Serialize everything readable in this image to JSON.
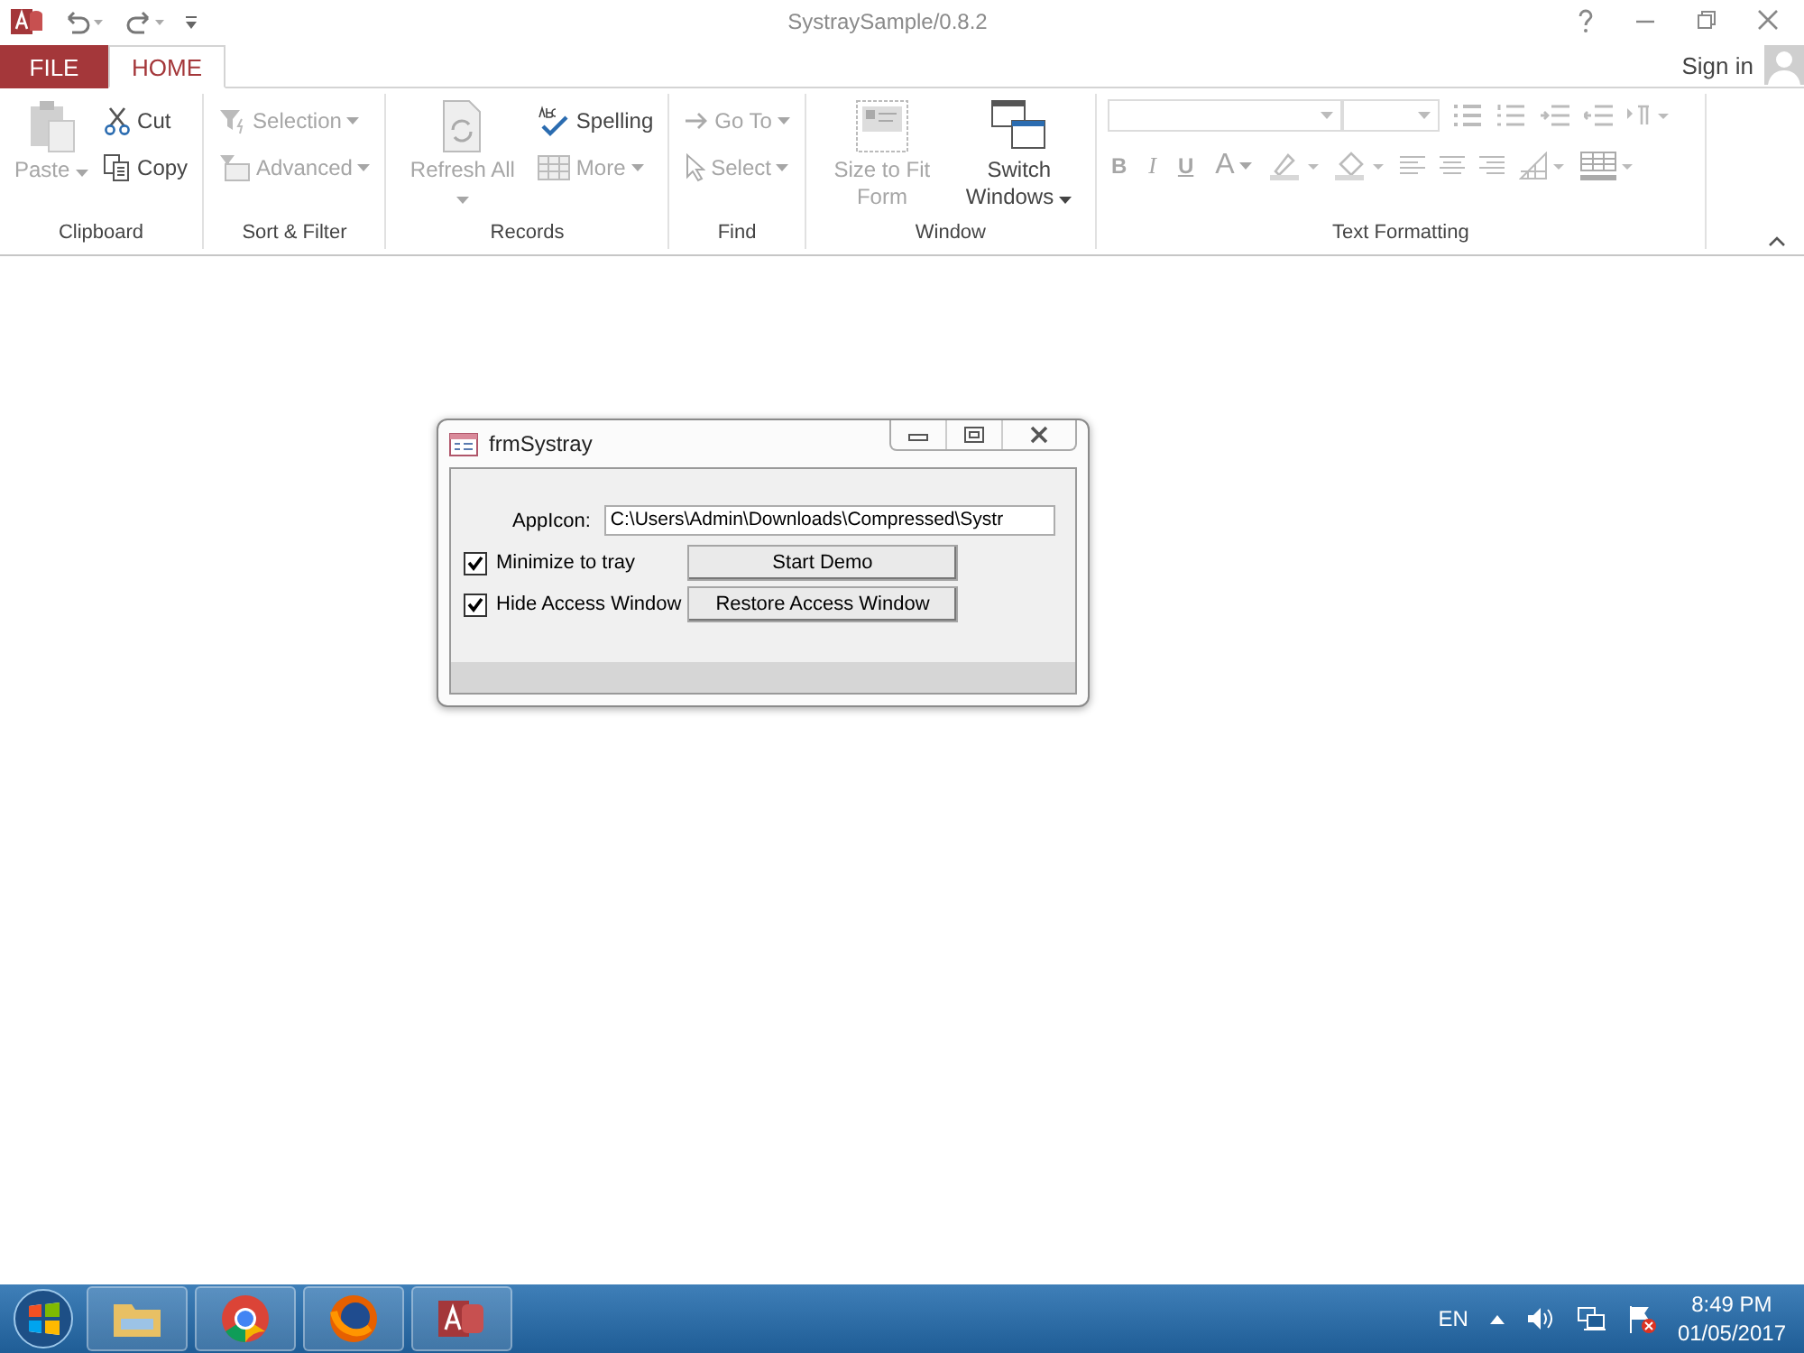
{
  "window": {
    "title": "SystraySample/0.8.2"
  },
  "tabs": [
    {
      "label": "FILE",
      "selected": false,
      "kind": "file"
    },
    {
      "label": "HOME",
      "selected": true,
      "kind": "normal"
    }
  ],
  "account": {
    "sign_in": "Sign in"
  },
  "ribbon": {
    "groups": [
      {
        "label": "Clipboard",
        "items": [
          {
            "label": "Paste",
            "kind": "large",
            "disabled": true,
            "dropdown": true
          },
          {
            "label": "Cut",
            "kind": "small",
            "disabled": false,
            "dropdown": false
          },
          {
            "label": "Copy",
            "kind": "small",
            "disabled": false,
            "dropdown": false
          }
        ]
      },
      {
        "label": "Sort & Filter",
        "items": [
          {
            "label": "Selection",
            "kind": "small",
            "disabled": true,
            "dropdown": true
          },
          {
            "label": "Advanced",
            "kind": "small",
            "disabled": true,
            "dropdown": true
          }
        ]
      },
      {
        "label": "Records",
        "items": [
          {
            "label": "Refresh All",
            "kind": "large",
            "disabled": true,
            "dropdown": true
          },
          {
            "label": "Spelling",
            "kind": "small",
            "disabled": false,
            "dropdown": false
          },
          {
            "label": "More",
            "kind": "small",
            "disabled": true,
            "dropdown": true
          }
        ]
      },
      {
        "label": "Find",
        "items": [
          {
            "label": "Go To",
            "kind": "small",
            "disabled": true,
            "dropdown": true
          },
          {
            "label": "Select",
            "kind": "small",
            "disabled": true,
            "dropdown": true
          }
        ]
      },
      {
        "label": "Window",
        "items": [
          {
            "label": "Size to Fit Form",
            "kind": "large",
            "disabled": true,
            "dropdown": false
          },
          {
            "label": "Switch Windows",
            "kind": "large",
            "disabled": false,
            "dropdown": true
          }
        ]
      },
      {
        "label": "Text Formatting",
        "items": [
          {
            "label": "B",
            "kind": "format",
            "disabled": true,
            "dropdown": false
          },
          {
            "label": "I",
            "kind": "format",
            "disabled": true,
            "dropdown": false
          },
          {
            "label": "U",
            "kind": "format",
            "disabled": true,
            "dropdown": false
          },
          {
            "label": "A",
            "kind": "format",
            "disabled": true,
            "dropdown": true
          }
        ]
      }
    ]
  },
  "form": {
    "title": "frmSystray",
    "app_icon_label": "AppIcon:",
    "app_icon_value": "C:\\Users\\Admin\\Downloads\\Compressed\\Systr",
    "checkboxes": [
      {
        "label": "Minimize to tray",
        "checked": true
      },
      {
        "label": "Hide Access Window",
        "checked": true
      }
    ],
    "buttons": [
      "Start Demo",
      "Restore Access Window"
    ]
  },
  "taskbar": {
    "language": "EN",
    "time": "8:49 PM",
    "date": "01/05/2017"
  }
}
